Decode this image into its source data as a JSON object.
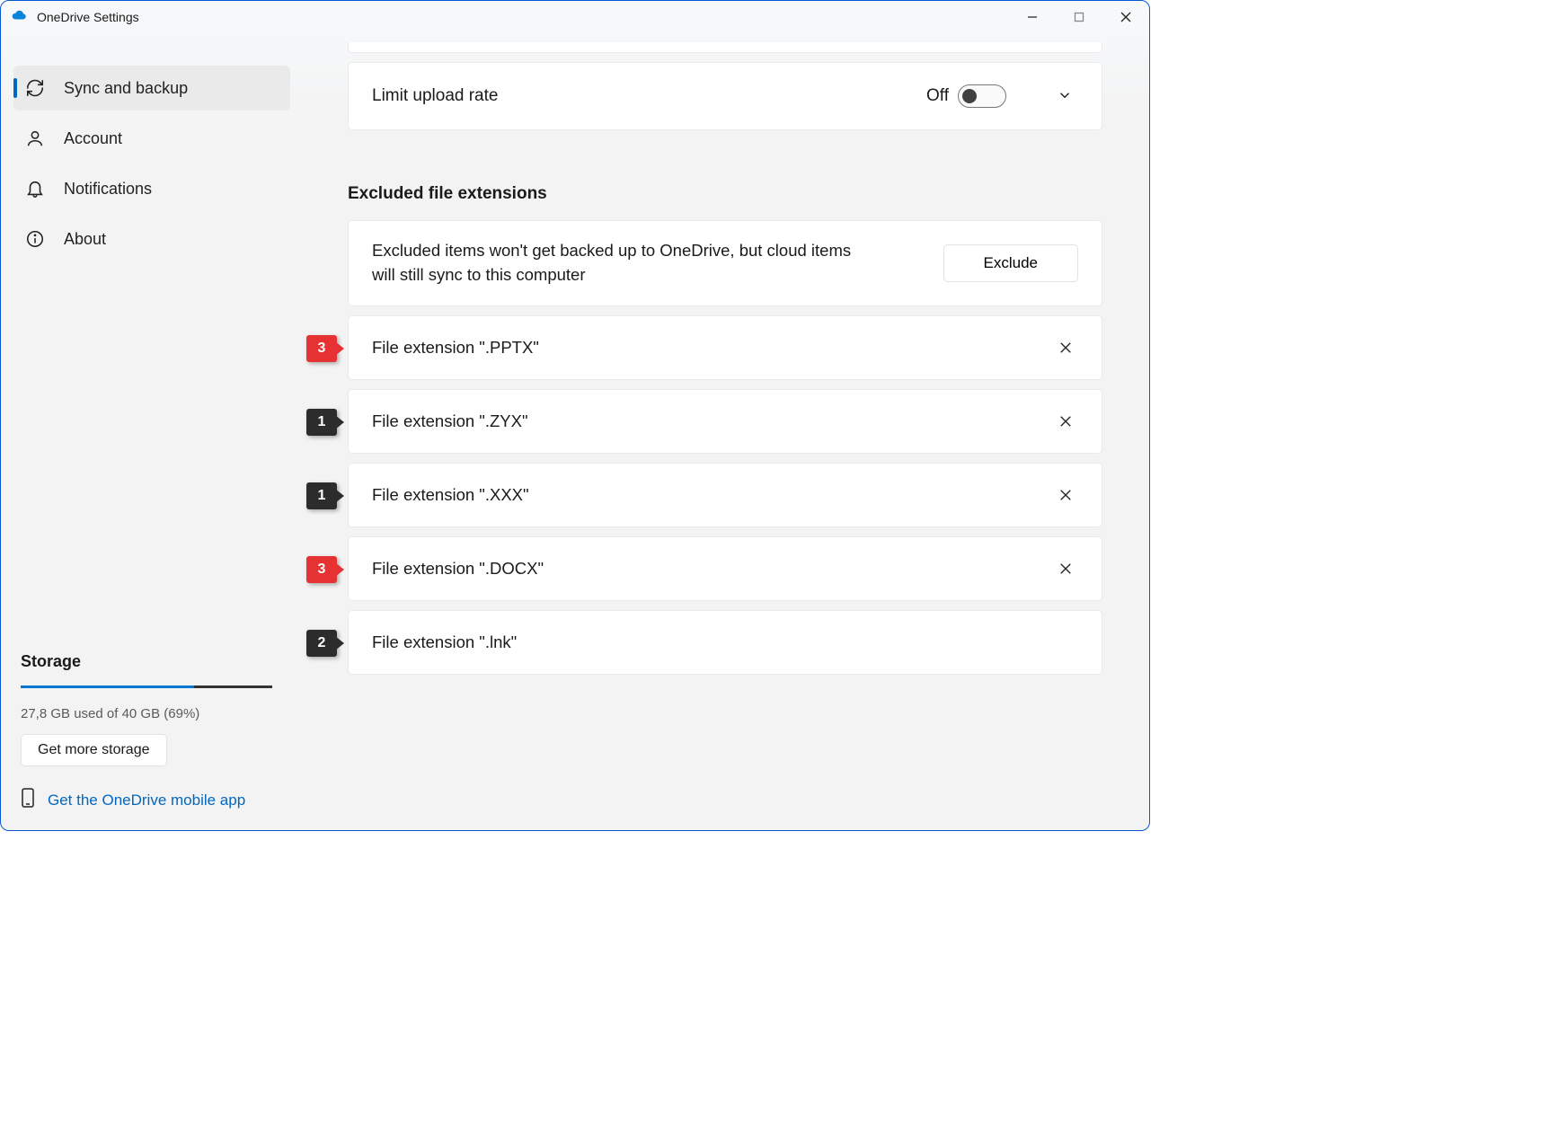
{
  "window": {
    "title": "OneDrive Settings"
  },
  "sidebar": {
    "items": [
      {
        "label": "Sync and backup"
      },
      {
        "label": "Account"
      },
      {
        "label": "Notifications"
      },
      {
        "label": "About"
      }
    ],
    "selected_index": 0
  },
  "storage": {
    "heading": "Storage",
    "used_text": "27,8 GB used of 40 GB (69%)",
    "percent": 69,
    "get_more_label": "Get more storage",
    "mobile_link": "Get the OneDrive mobile app"
  },
  "upload_rate": {
    "label": "Limit upload rate",
    "state": "Off"
  },
  "excluded": {
    "heading": "Excluded file extensions",
    "description": "Excluded items won't get backed up to OneDrive, but cloud items will still sync to this computer",
    "exclude_button": "Exclude",
    "items": [
      {
        "label": "File extension \".PPTX\"",
        "badge": "3",
        "badge_color": "red",
        "removable": true
      },
      {
        "label": "File extension \".ZYX\"",
        "badge": "1",
        "badge_color": "dark",
        "removable": true
      },
      {
        "label": "File extension \".XXX\"",
        "badge": "1",
        "badge_color": "dark",
        "removable": true
      },
      {
        "label": "File extension \".DOCX\"",
        "badge": "3",
        "badge_color": "red",
        "removable": true
      },
      {
        "label": "File extension \".lnk\"",
        "badge": "2",
        "badge_color": "dark",
        "removable": false
      }
    ]
  }
}
